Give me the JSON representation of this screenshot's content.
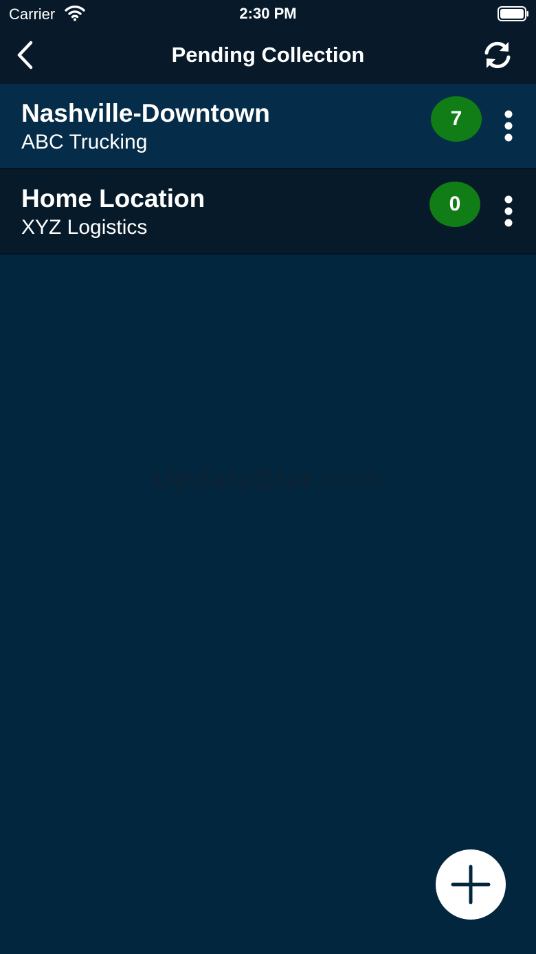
{
  "status_bar": {
    "carrier": "Carrier",
    "time": "2:30 PM"
  },
  "nav": {
    "title": "Pending Collection"
  },
  "locations": [
    {
      "name": "Nashville-Downtown",
      "company": "ABC Trucking",
      "count": "7"
    },
    {
      "name": "Home Location",
      "company": "XYZ Logistics",
      "count": "0"
    }
  ],
  "watermark": "UpdateStar.com",
  "colors": {
    "background": "#03263f",
    "header": "#081a2a",
    "row_highlight": "#052c48",
    "row_dark": "#071a29",
    "badge": "#117d16"
  },
  "icons": {
    "back": "chevron-left-icon",
    "refresh": "refresh-icon",
    "more": "more-vertical-icon",
    "add": "plus-icon"
  }
}
